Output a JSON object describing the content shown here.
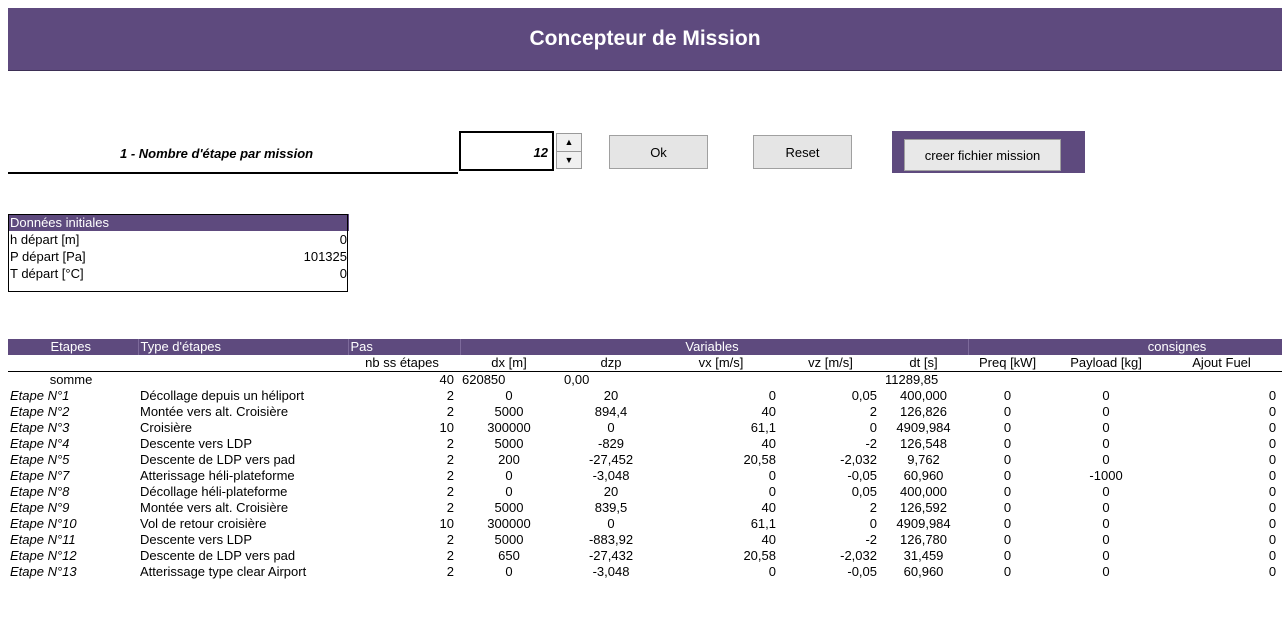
{
  "header": {
    "title": "Concepteur de Mission"
  },
  "controls": {
    "question_label": "1 -  Nombre d'étape par mission",
    "steps_value": "12",
    "spin_up": "▲",
    "spin_down": "▼",
    "ok_label": "Ok",
    "reset_label": "Reset",
    "create_label": "creer fichier mission"
  },
  "initial_data": {
    "title": "Données initiales",
    "rows": [
      {
        "label": "h départ [m]",
        "value": "0"
      },
      {
        "label": "P départ [Pa]",
        "value": "101325"
      },
      {
        "label": "T départ [°C]",
        "value": "0"
      }
    ]
  },
  "mission_table": {
    "group_headers": {
      "etapes": "Etapes",
      "type": "Type d'étapes",
      "pas": "Pas",
      "variables": "Variables",
      "consignes": "consignes"
    },
    "columns": [
      "nb ss étapes",
      "dx [m]",
      "dzp",
      "vx [m/s]",
      "vz [m/s]",
      "dt [s]",
      "Preq [kW]",
      "Payload [kg]",
      "Ajout Fuel"
    ],
    "sum_row": {
      "label": "somme",
      "nb": "40",
      "dx": "620850",
      "dzp": "0,00",
      "dt": "11289,85"
    },
    "rows": [
      [
        "Etape N°1",
        "Décollage depuis un héliport",
        "2",
        "0",
        "20",
        "0",
        "0,05",
        "400,000",
        "0",
        "0",
        "0"
      ],
      [
        "Etape N°2",
        "Montée vers alt. Croisière",
        "2",
        "5000",
        "894,4",
        "40",
        "2",
        "126,826",
        "0",
        "0",
        "0"
      ],
      [
        "Etape N°3",
        "Croisière",
        "10",
        "300000",
        "0",
        "61,1",
        "0",
        "4909,984",
        "0",
        "0",
        "0"
      ],
      [
        "Etape N°4",
        "Descente vers LDP",
        "2",
        "5000",
        "-829",
        "40",
        "-2",
        "126,548",
        "0",
        "0",
        "0"
      ],
      [
        "Etape N°5",
        "Descente de LDP vers pad",
        "2",
        "200",
        "-27,452",
        "20,58",
        "-2,032",
        "9,762",
        "0",
        "0",
        "0"
      ],
      [
        "Etape N°7",
        "Atterissage héli-plateforme",
        "2",
        "0",
        "-3,048",
        "0",
        "-0,05",
        "60,960",
        "0",
        "-1000",
        "0"
      ],
      [
        "Etape N°8",
        "Décollage héli-plateforme",
        "2",
        "0",
        "20",
        "0",
        "0,05",
        "400,000",
        "0",
        "0",
        "0"
      ],
      [
        "Etape N°9",
        "Montée vers alt. Croisière",
        "2",
        "5000",
        "839,5",
        "40",
        "2",
        "126,592",
        "0",
        "0",
        "0"
      ],
      [
        "Etape N°10",
        "Vol de retour croisière",
        "10",
        "300000",
        "0",
        "61,1",
        "0",
        "4909,984",
        "0",
        "0",
        "0"
      ],
      [
        "Etape N°11",
        "Descente vers LDP",
        "2",
        "5000",
        "-883,92",
        "40",
        "-2",
        "126,780",
        "0",
        "0",
        "0"
      ],
      [
        "Etape N°12",
        "Descente de LDP vers pad",
        "2",
        "650",
        "-27,432",
        "20,58",
        "-2,032",
        "31,459",
        "0",
        "0",
        "0"
      ],
      [
        "Etape N°13",
        "Atterissage type clear Airport",
        "2",
        "0",
        "-3,048",
        "0",
        "-0,05",
        "60,960",
        "0",
        "0",
        "0"
      ]
    ]
  },
  "colors": {
    "accent": "#5e4a7e"
  }
}
